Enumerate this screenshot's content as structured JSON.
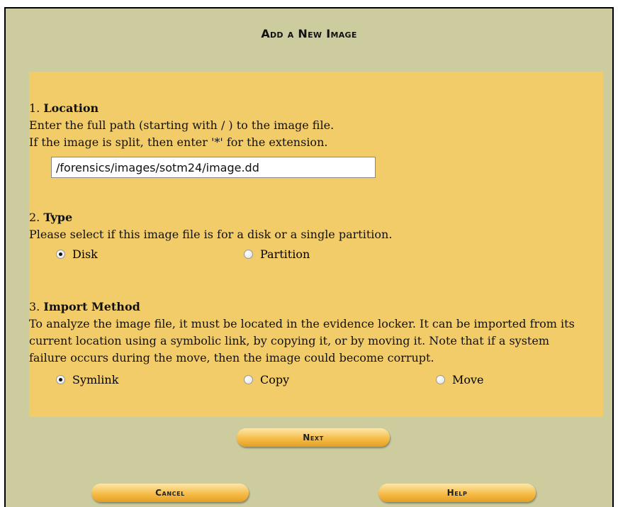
{
  "title": "Add a New Image",
  "location": {
    "number": "1.",
    "heading": "Location",
    "line1": "Enter the full path (starting with / ) to the image file.",
    "line2": "If the image is split, then enter '*' for the extension.",
    "path_value": "/forensics/images/sotm24/image.dd"
  },
  "type": {
    "number": "2.",
    "heading": "Type",
    "desc": "Please select if this image file is for a disk or a single partition.",
    "options": [
      {
        "label": "Disk",
        "selected": true
      },
      {
        "label": "Partition",
        "selected": false
      }
    ]
  },
  "import_method": {
    "number": "3.",
    "heading": "Import Method",
    "line1": "To analyze the image file, it must be located in the evidence locker. It can be imported from its",
    "line2": "current location using a symbolic link, by copying it, or by moving it. Note that if a system",
    "line3": "failure occurs during the move, then the image could become corrupt.",
    "options": [
      {
        "label": "Symlink",
        "selected": true
      },
      {
        "label": "Copy",
        "selected": false
      },
      {
        "label": "Move",
        "selected": false
      }
    ]
  },
  "buttons": {
    "next": "Next",
    "cancel": "Cancel",
    "help": "Help"
  },
  "colors": {
    "outer_background": "#cccc9f",
    "form_background": "#f3cc6a",
    "button_gradient": "#f5b942"
  }
}
